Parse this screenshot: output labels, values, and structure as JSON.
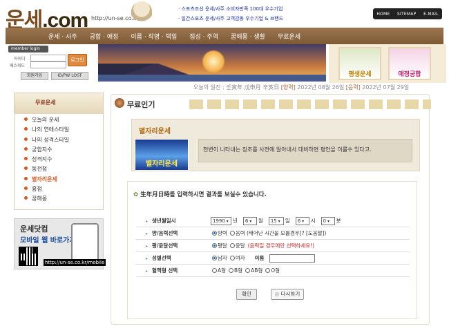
{
  "header": {
    "logo_main": "운세",
    "logo_dot": ".com",
    "url": "http://un-se.co.kr",
    "awards": [
      "· 스포츠조선 운세/사주 소비자만족 100대 우수기업",
      "· 일간스포츠 운세/사주 고객감동 우수기업 & 브랜드"
    ],
    "top_links": [
      "HOME",
      "SITEMAP",
      "E-MAIL"
    ]
  },
  "nav": [
    "운세 · 사주",
    "궁합 · 애정",
    "이름 · 작명 · 택일",
    "점성 · 주역",
    "꿈해몽 · 생활",
    "무료운세"
  ],
  "login": {
    "title": "member login",
    "id_label": "아이디",
    "pw_label": "패스워드",
    "login_btn": "로그인",
    "join_btn": "회원가입",
    "lost_btn": "ID/PW LOST"
  },
  "promos": [
    "평생운세",
    "애정궁합"
  ],
  "today": {
    "label": "오늘의 일진 :",
    "ganji": "壬寅年 戊申月 辛亥日",
    "solar_tag": "[양력]",
    "solar": "2022년 08월 26일",
    "lunar_tag": "[음력]",
    "lunar": "2022년 07월 29일"
  },
  "sidebar": {
    "title": "무료운세",
    "items": [
      "오늘의 운세",
      "나의 연애스타일",
      "나의 성격스타일",
      "궁합지수",
      "성격지수",
      "동전점",
      "별자리운세",
      "흉점",
      "꿈해몽"
    ],
    "active_index": 6
  },
  "mobile_ad": {
    "line1": "운세닷컴",
    "line2": "모바일 웹 바로가기!",
    "url": "http://un-se.co.kr/mobile"
  },
  "main": {
    "title": "무료인기",
    "section_title": "별자리운세",
    "image_label": "별자리운세",
    "description": "천변이 나타내는 징조를 사전에 알아내서 대비하면 평안을 이룰수 있다고.",
    "form_heading": "生年月日時를 입력하시면 결과를 보실수 있습니다.",
    "rows": {
      "birth": {
        "label": "생년월일시",
        "year": "1990",
        "year_unit": "년",
        "month": "6",
        "month_unit": "월",
        "day": "15",
        "day_unit": "일",
        "hour": "6",
        "hour_unit": "시",
        "minute": "0",
        "minute_unit": "분"
      },
      "calendar": {
        "label": "양/음력선택",
        "opt1": "양력",
        "opt2": "음력 (태어난 시간을 모를경우[? [도움말])"
      },
      "leap": {
        "label": "평/윤달선택",
        "opt1": "평달",
        "opt2": "윤달",
        "note": "(음력일 경우에만 선택하세요!)"
      },
      "gender": {
        "label": "성별선택",
        "opt1": "남자",
        "opt2": "여자",
        "name_label": "이름"
      },
      "blood": {
        "label": "혈액형 선택",
        "opts": [
          "A형",
          "B형",
          "AB형",
          "O형"
        ]
      }
    },
    "confirm_btn": "확인",
    "reset_btn": "다시하기"
  }
}
